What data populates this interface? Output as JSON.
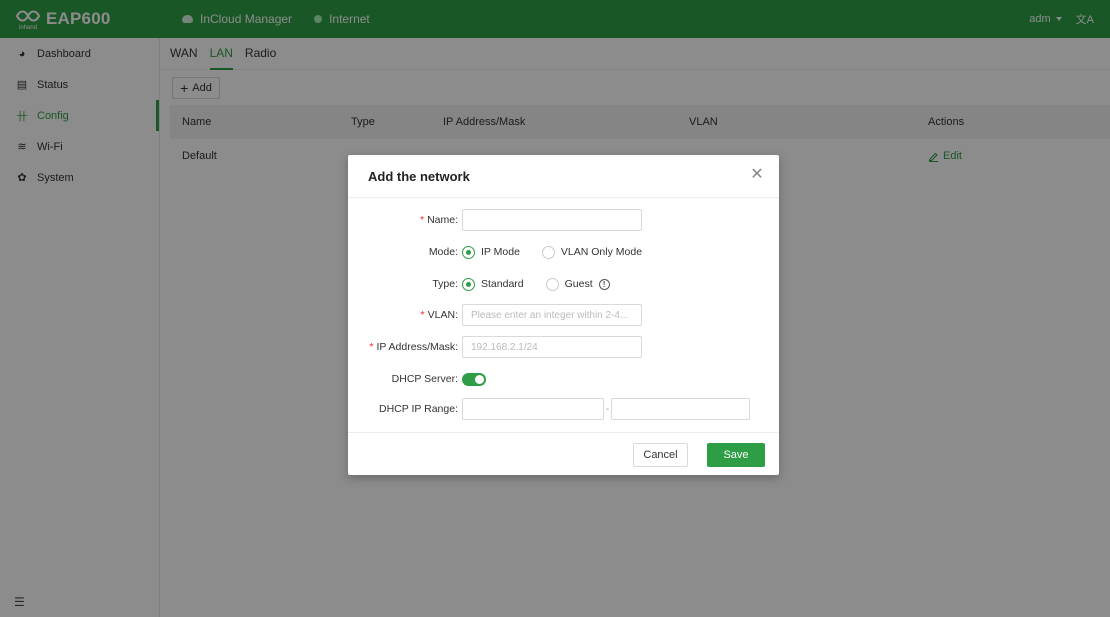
{
  "app": {
    "brand_logo_text": "inhand",
    "product_name": "EAP600"
  },
  "topbar": {
    "cloud_label": "InCloud Manager",
    "internet_label": "Internet",
    "user_label": "adm",
    "lang_icon": "translate-icon",
    "lang_glyph": "文A"
  },
  "sidebar": {
    "items": [
      {
        "label": "Dashboard",
        "icon": "dashboard-icon",
        "glyph": "◕"
      },
      {
        "label": "Status",
        "icon": "status-icon",
        "glyph": "▤"
      },
      {
        "label": "Config",
        "icon": "config-icon",
        "glyph": "卄",
        "active": true
      },
      {
        "label": "Wi-Fi",
        "icon": "wifi-icon",
        "glyph": "≋"
      },
      {
        "label": "System",
        "icon": "gear-icon",
        "glyph": "✿"
      }
    ],
    "collapse_glyph": "☰"
  },
  "tabs": [
    {
      "label": "WAN",
      "active": false
    },
    {
      "label": "LAN",
      "active": true
    },
    {
      "label": "Radio",
      "active": false
    }
  ],
  "toolbar": {
    "add_label": "Add",
    "add_glyph": "+"
  },
  "table": {
    "columns": [
      "Name",
      "Type",
      "IP Address/Mask",
      "VLAN",
      "Actions"
    ],
    "rows": [
      {
        "name": "Default",
        "edit_label": "Edit"
      }
    ]
  },
  "modal": {
    "title": "Add the network",
    "close_glyph": "✕",
    "fields": {
      "name_label": "Name:",
      "mode_label": "Mode:",
      "mode_options": [
        "IP Mode",
        "VLAN Only Mode"
      ],
      "mode_selected": "IP Mode",
      "type_label": "Type:",
      "type_options": [
        "Standard",
        "Guest"
      ],
      "type_selected": "Standard",
      "vlan_label": "VLAN:",
      "vlan_placeholder": "Please enter an integer within 2-4...",
      "ip_label": "IP Address/Mask:",
      "ip_placeholder": "192.168.2.1/24",
      "dhcp_server_label": "DHCP Server:",
      "dhcp_server_on": true,
      "dhcp_range_label": "DHCP IP Range:",
      "dhcp_range_separator": "-"
    },
    "buttons": {
      "cancel": "Cancel",
      "save": "Save"
    }
  },
  "colors": {
    "brand": "#2e9e46",
    "required": "#f5222d"
  }
}
